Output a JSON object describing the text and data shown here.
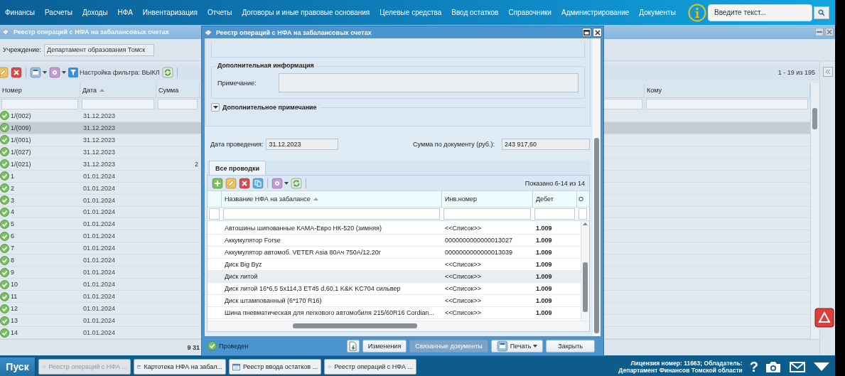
{
  "menu": {
    "items": [
      "Финансы",
      "Расчеты",
      "Доходы",
      "НФА",
      "Инвентаризация",
      "Отчеты",
      "Договоры и иные правовые основания",
      "Целевые средства",
      "Ввод остатков",
      "Справочники",
      "Администрирование",
      "Документы"
    ],
    "search": {
      "placeholder": "Введите текст..."
    }
  },
  "main_window": {
    "title": "Реестр операций с НФА на забалансовых счетах",
    "institution": {
      "label": "Учреждение:",
      "value": "Департамент образования Томск"
    },
    "filter_label": "Настройка фильтра: ВЫКЛ",
    "pager": "1 - 19 из 195",
    "columns": [
      "Номер",
      "Дата",
      "Сумма",
      "Кому"
    ],
    "rows": [
      {
        "number": "1/(002)",
        "date": "31.12.2023",
        "amount": "",
        "selected": false
      },
      {
        "number": "1/(009)",
        "date": "31.12.2023",
        "amount": "",
        "selected": true
      },
      {
        "number": "1/(001)",
        "date": "31.12.2023",
        "amount": "",
        "selected": false
      },
      {
        "number": "1/(027)",
        "date": "31.12.2023",
        "amount": "",
        "selected": false
      },
      {
        "number": "1/(021)",
        "date": "31.12.2023",
        "amount": "2",
        "selected": false
      },
      {
        "number": "1",
        "date": "01.01.2024",
        "amount": "",
        "selected": false
      },
      {
        "number": "2",
        "date": "01.01.2024",
        "amount": "",
        "selected": false
      },
      {
        "number": "3",
        "date": "01.01.2024",
        "amount": "",
        "selected": false
      },
      {
        "number": "4",
        "date": "01.01.2024",
        "amount": "",
        "selected": false
      },
      {
        "number": "5",
        "date": "01.01.2024",
        "amount": "",
        "selected": false
      },
      {
        "number": "6",
        "date": "01.01.2024",
        "amount": "",
        "selected": false
      },
      {
        "number": "7",
        "date": "01.01.2024",
        "amount": "",
        "selected": false
      },
      {
        "number": "8",
        "date": "01.01.2024",
        "amount": "",
        "selected": false
      },
      {
        "number": "9",
        "date": "01.01.2024",
        "amount": "",
        "selected": false
      },
      {
        "number": "10",
        "date": "01.01.2024",
        "amount": "",
        "selected": false
      },
      {
        "number": "11",
        "date": "01.01.2024",
        "amount": "",
        "selected": false
      },
      {
        "number": "12",
        "date": "01.01.2024",
        "amount": "",
        "selected": false
      },
      {
        "number": "13",
        "date": "01.01.2024",
        "amount": "",
        "selected": false
      },
      {
        "number": "14",
        "date": "01.01.2024",
        "amount": "",
        "selected": false
      }
    ],
    "total": "9 31"
  },
  "modal": {
    "title": "Реестр операций с НФА на забалансовых счетах",
    "additional_info": {
      "legend": "Дополнительная информация",
      "note_label": "Примечание:"
    },
    "extra_note": {
      "label": "Дополнительное примечание",
      "expanded": false
    },
    "date_label": "Дата проведения:",
    "date_value": "31.12.2023",
    "sum_label": "Сумма по документу (руб.):",
    "sum_value": "243 917,60",
    "tabs": [
      {
        "label": "Все проводки",
        "selected": true
      }
    ],
    "grid": {
      "pager": "Показано 6-14 из 14",
      "columns": [
        "Название НФА на забалансе",
        "Инв.номер",
        "Дебет",
        "О"
      ],
      "rows": [
        {
          "name": "Автошины шипованные КАМА-Евро НК-520 (зимняя)",
          "inv": "<<Список>>",
          "debit": "1.009",
          "selected": false
        },
        {
          "name": "Аккумулятор Forse",
          "inv": "0000000000000013027",
          "debit": "1.009",
          "selected": false
        },
        {
          "name": "Аккумулятор автомоб. VETER Asia 80Ач 750A/12.20г",
          "inv": "0000000000000013039",
          "debit": "1.009",
          "selected": false
        },
        {
          "name": "Диск Big Byz",
          "inv": "<<Список>>",
          "debit": "1.009",
          "selected": false
        },
        {
          "name": "Диск литой",
          "inv": "<<Список>>",
          "debit": "1.009",
          "selected": true
        },
        {
          "name": "Диск литой 16*6,5 5x114,3 ET45 d.60,1 K&K KC704 сильвер",
          "inv": "<<Список>>",
          "debit": "1.009",
          "selected": false
        },
        {
          "name": "Диск штампованный (6*170 R16)",
          "inv": "<<Список>>",
          "debit": "1.009",
          "selected": false
        },
        {
          "name": "Шина пневматическая для легкового автомобиля 215/60R16 Cordian...",
          "inv": "<<Список>>",
          "debit": "1.009",
          "selected": false
        }
      ]
    },
    "status": "Проведен",
    "buttons": [
      {
        "label": "Изменения",
        "kind": "plain",
        "disabled": false
      },
      {
        "label": "Связанные документы",
        "kind": "plain",
        "disabled": true
      },
      {
        "label": "Печать",
        "kind": "print",
        "disabled": false
      },
      {
        "label": "Закрыть",
        "kind": "plain",
        "disabled": false
      }
    ]
  },
  "taskbar": {
    "start": "Пуск",
    "tasks": [
      {
        "label": "Реестр операций с НФА ...",
        "kind": "registry",
        "selected": true
      },
      {
        "label": "Картотека НФА на забал...",
        "kind": "table",
        "selected": false
      },
      {
        "label": "Реестр ввода остатков ...",
        "kind": "table",
        "selected": false
      },
      {
        "label": "Реестр операций с НФА ...",
        "kind": "registry",
        "selected": false
      }
    ],
    "license": [
      "Лицензия номер: 11663; Обладатель:",
      "Департамент Финансов Томской области"
    ],
    "help": "?"
  }
}
